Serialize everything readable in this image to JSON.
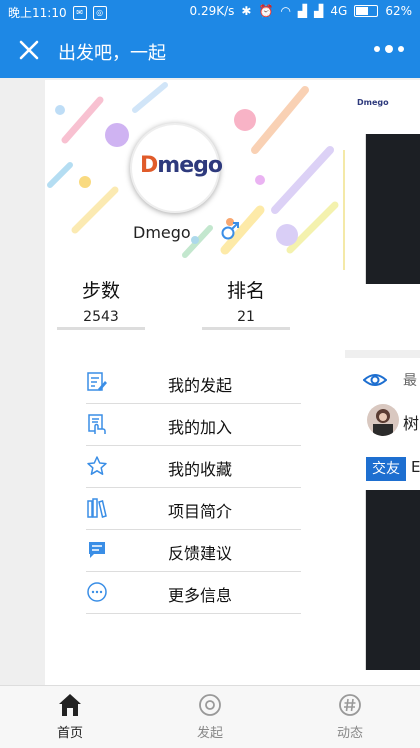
{
  "status_bar": {
    "time": "晚上11:10",
    "net_speed": "0.29K/s",
    "network": "4G",
    "battery": "62%"
  },
  "app_bar": {
    "title": "出发吧，一起"
  },
  "profile": {
    "logo_text": "mego",
    "logo_d": "D",
    "username": "Dmego",
    "stats": [
      {
        "label": "步数",
        "value": "2543"
      },
      {
        "label": "排名",
        "value": "21"
      }
    ]
  },
  "menu": [
    {
      "label": "我的发起",
      "icon": "edit-doc-icon"
    },
    {
      "label": "我的加入",
      "icon": "hand-doc-icon"
    },
    {
      "label": "我的收藏",
      "icon": "star-icon"
    },
    {
      "label": "项目简介",
      "icon": "books-icon"
    },
    {
      "label": "反馈建议",
      "icon": "chat-icon"
    },
    {
      "label": "更多信息",
      "icon": "more-circle-icon"
    }
  ],
  "side_card": {
    "logo": "Dmego",
    "latest_text": "最",
    "user_name": "树",
    "badge": "交友",
    "after_badge": "E"
  },
  "tabs": [
    {
      "label": "首页",
      "icon": "home-icon",
      "active": true
    },
    {
      "label": "发起",
      "icon": "launch-icon",
      "active": false
    },
    {
      "label": "动态",
      "icon": "hashtag-icon",
      "active": false
    }
  ],
  "colors": {
    "primary": "#1e88e5",
    "icon_blue": "#3a8ee6",
    "badge": "#1e6fd0"
  }
}
